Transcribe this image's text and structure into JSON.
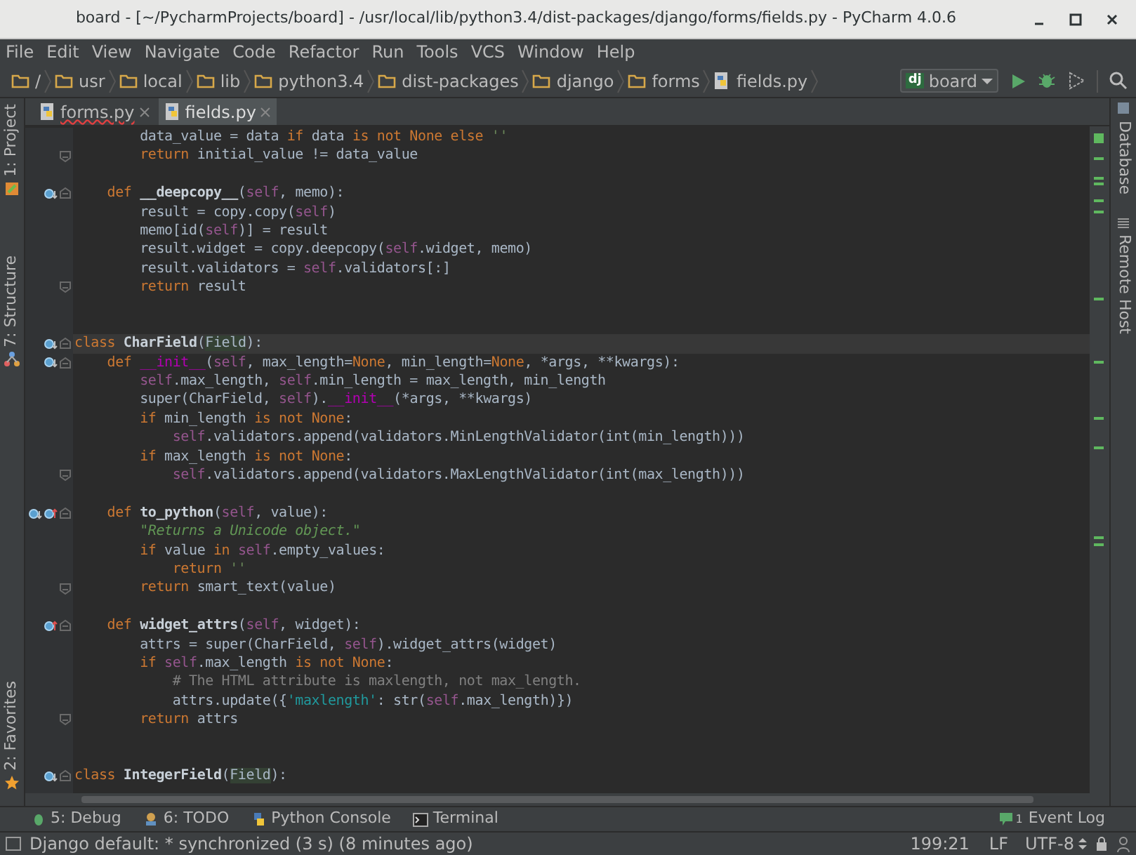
{
  "window": {
    "title": "board - [~/PycharmProjects/board] - /usr/local/lib/python3.4/dist-packages/django/forms/fields.py - PyCharm 4.0.6"
  },
  "menu": [
    "File",
    "Edit",
    "View",
    "Navigate",
    "Code",
    "Refactor",
    "Run",
    "Tools",
    "VCS",
    "Window",
    "Help"
  ],
  "breadcrumbs": [
    {
      "label": "/",
      "kind": "folder"
    },
    {
      "label": "usr",
      "kind": "folder"
    },
    {
      "label": "local",
      "kind": "folder"
    },
    {
      "label": "lib",
      "kind": "folder"
    },
    {
      "label": "python3.4",
      "kind": "folder"
    },
    {
      "label": "dist-packages",
      "kind": "folder"
    },
    {
      "label": "django",
      "kind": "folder"
    },
    {
      "label": "forms",
      "kind": "folder"
    },
    {
      "label": "fields.py",
      "kind": "file"
    }
  ],
  "run_config": {
    "badge": "dj",
    "label": "board"
  },
  "tabs": [
    {
      "label": "forms.py",
      "selected": false,
      "error": true
    },
    {
      "label": "fields.py",
      "selected": true,
      "error": false
    }
  ],
  "left_tools": [
    "1: Project",
    "7: Structure",
    "2: Favorites"
  ],
  "right_tools": [
    "Database",
    "Remote Host"
  ],
  "code_lines": [
    {
      "kind": "plain",
      "current": false,
      "tokens": [
        {
          "kind": "p",
          "text": "        data_value = data "
        },
        {
          "kind": "kw",
          "text": "if"
        },
        {
          "kind": "p",
          "text": " data "
        },
        {
          "kind": "kw",
          "text": "is not None else"
        },
        {
          "kind": "str",
          "text": " ''"
        }
      ]
    },
    {
      "kind": "fold_end",
      "current": false,
      "tokens": [
        {
          "kind": "kw",
          "text": "        return"
        },
        {
          "kind": "p",
          "text": " initial_value != data_value"
        }
      ]
    },
    {
      "kind": "blank",
      "current": false
    },
    {
      "kind": "fold_start",
      "current": false,
      "overrides": [
        {
          "kind": "down"
        }
      ],
      "tokens": [
        {
          "kind": "kw",
          "text": "    def"
        },
        {
          "kind": "fn",
          "text": " __deepcopy__"
        },
        {
          "kind": "p",
          "text": "("
        },
        {
          "kind": "self",
          "text": "self"
        },
        {
          "kind": "p",
          "text": ", memo):"
        }
      ]
    },
    {
      "kind": "plain",
      "current": false,
      "tokens": [
        {
          "kind": "p",
          "text": "        result = copy.copy("
        },
        {
          "kind": "self",
          "text": "self"
        },
        {
          "kind": "p",
          "text": ")"
        }
      ]
    },
    {
      "kind": "plain",
      "current": false,
      "tokens": [
        {
          "kind": "p",
          "text": "        memo[id("
        },
        {
          "kind": "self",
          "text": "self"
        },
        {
          "kind": "p",
          "text": ")] = result"
        }
      ]
    },
    {
      "kind": "plain",
      "current": false,
      "tokens": [
        {
          "kind": "p",
          "text": "        result.widget = copy.deepcopy("
        },
        {
          "kind": "self",
          "text": "self"
        },
        {
          "kind": "p",
          "text": ".widget, memo)"
        }
      ]
    },
    {
      "kind": "plain",
      "current": false,
      "tokens": [
        {
          "kind": "p",
          "text": "        result.validators = "
        },
        {
          "kind": "self",
          "text": "self"
        },
        {
          "kind": "p",
          "text": ".validators[:]"
        }
      ]
    },
    {
      "kind": "fold_end",
      "current": false,
      "tokens": [
        {
          "kind": "kw",
          "text": "        return"
        },
        {
          "kind": "p",
          "text": " result"
        }
      ]
    },
    {
      "kind": "blank",
      "current": false
    },
    {
      "kind": "blank",
      "current": false
    },
    {
      "kind": "fold_start",
      "current": true,
      "overrides": [
        {
          "kind": "down"
        }
      ],
      "tokens": [
        {
          "kind": "kw",
          "text": "class"
        },
        {
          "kind": "fn",
          "text": " CharField"
        },
        {
          "kind": "p",
          "text": "("
        },
        {
          "kind": "ref",
          "text": "Field"
        },
        {
          "kind": "p",
          "text": "):"
        }
      ]
    },
    {
      "kind": "fold_start",
      "current": false,
      "overrides": [
        {
          "kind": "down"
        }
      ],
      "tokens": [
        {
          "kind": "kw",
          "text": "    def"
        },
        {
          "kind": "magic",
          "text": " __init__"
        },
        {
          "kind": "p",
          "text": "("
        },
        {
          "kind": "self",
          "text": "self"
        },
        {
          "kind": "p",
          "text": ", max_length="
        },
        {
          "kind": "kw",
          "text": "None"
        },
        {
          "kind": "p",
          "text": ", min_length="
        },
        {
          "kind": "kw",
          "text": "None"
        },
        {
          "kind": "p",
          "text": ", *args, **kwargs):"
        }
      ]
    },
    {
      "kind": "plain",
      "current": false,
      "tokens": [
        {
          "kind": "self",
          "text": "        self"
        },
        {
          "kind": "p",
          "text": ".max_length, "
        },
        {
          "kind": "self",
          "text": "self"
        },
        {
          "kind": "p",
          "text": ".min_length = max_length, min_length"
        }
      ]
    },
    {
      "kind": "plain",
      "current": false,
      "tokens": [
        {
          "kind": "p",
          "text": "        super(CharField, "
        },
        {
          "kind": "self",
          "text": "self"
        },
        {
          "kind": "p",
          "text": ")."
        },
        {
          "kind": "magic",
          "text": "__init__"
        },
        {
          "kind": "p",
          "text": "(*args, **kwargs)"
        }
      ]
    },
    {
      "kind": "plain",
      "current": false,
      "tokens": [
        {
          "kind": "kw",
          "text": "        if"
        },
        {
          "kind": "p",
          "text": " min_length "
        },
        {
          "kind": "kw",
          "text": "is not None"
        },
        {
          "kind": "p",
          "text": ":"
        }
      ]
    },
    {
      "kind": "plain",
      "current": false,
      "tokens": [
        {
          "kind": "self",
          "text": "            self"
        },
        {
          "kind": "p",
          "text": ".validators.append(validators.MinLengthValidator(int(min_length)))"
        }
      ]
    },
    {
      "kind": "plain",
      "current": false,
      "tokens": [
        {
          "kind": "kw",
          "text": "        if"
        },
        {
          "kind": "p",
          "text": " max_length "
        },
        {
          "kind": "kw",
          "text": "is not None"
        },
        {
          "kind": "p",
          "text": ":"
        }
      ]
    },
    {
      "kind": "fold_end",
      "current": false,
      "tokens": [
        {
          "kind": "self",
          "text": "            self"
        },
        {
          "kind": "p",
          "text": ".validators.append(validators.MaxLengthValidator(int(max_length)))"
        }
      ]
    },
    {
      "kind": "blank",
      "current": false
    },
    {
      "kind": "fold_start",
      "current": false,
      "overrides": [
        {
          "kind": "down"
        },
        {
          "kind": "up"
        }
      ],
      "tokens": [
        {
          "kind": "kw",
          "text": "    def"
        },
        {
          "kind": "fn",
          "text": " to_python"
        },
        {
          "kind": "p",
          "text": "("
        },
        {
          "kind": "self",
          "text": "self"
        },
        {
          "kind": "p",
          "text": ", value):"
        }
      ]
    },
    {
      "kind": "plain",
      "current": false,
      "tokens": [
        {
          "kind": "doc",
          "text": "        \"Returns a Unicode object.\""
        }
      ]
    },
    {
      "kind": "plain",
      "current": false,
      "tokens": [
        {
          "kind": "kw",
          "text": "        if"
        },
        {
          "kind": "p",
          "text": " value "
        },
        {
          "kind": "kw",
          "text": "in"
        },
        {
          "kind": "self",
          "text": " self"
        },
        {
          "kind": "p",
          "text": ".empty_values:"
        }
      ]
    },
    {
      "kind": "plain",
      "current": false,
      "tokens": [
        {
          "kind": "kw",
          "text": "            return"
        },
        {
          "kind": "str",
          "text": " ''"
        }
      ]
    },
    {
      "kind": "fold_end",
      "current": false,
      "tokens": [
        {
          "kind": "kw",
          "text": "        return"
        },
        {
          "kind": "p",
          "text": " smart_text(value)"
        }
      ]
    },
    {
      "kind": "blank",
      "current": false
    },
    {
      "kind": "fold_start",
      "current": false,
      "overrides": [
        {
          "kind": "up"
        }
      ],
      "tokens": [
        {
          "kind": "kw",
          "text": "    def"
        },
        {
          "kind": "fn",
          "text": " widget_attrs"
        },
        {
          "kind": "p",
          "text": "("
        },
        {
          "kind": "self",
          "text": "self"
        },
        {
          "kind": "p",
          "text": ", widget):"
        }
      ]
    },
    {
      "kind": "plain",
      "current": false,
      "tokens": [
        {
          "kind": "p",
          "text": "        attrs = super(CharField, "
        },
        {
          "kind": "self",
          "text": "self"
        },
        {
          "kind": "p",
          "text": ").widget_attrs(widget)"
        }
      ]
    },
    {
      "kind": "plain",
      "current": false,
      "tokens": [
        {
          "kind": "kw",
          "text": "        if"
        },
        {
          "kind": "self",
          "text": " self"
        },
        {
          "kind": "p",
          "text": ".max_length "
        },
        {
          "kind": "kw",
          "text": "is not None"
        },
        {
          "kind": "p",
          "text": ":"
        }
      ]
    },
    {
      "kind": "plain",
      "current": false,
      "tokens": [
        {
          "kind": "cmt",
          "text": "            # The HTML attribute is maxlength, not max_length."
        }
      ]
    },
    {
      "kind": "plain",
      "current": false,
      "tokens": [
        {
          "kind": "p",
          "text": "            attrs.update({"
        },
        {
          "kind": "str2",
          "text": "'maxlength'"
        },
        {
          "kind": "p",
          "text": ": str("
        },
        {
          "kind": "self",
          "text": "self"
        },
        {
          "kind": "p",
          "text": ".max_length)})"
        }
      ]
    },
    {
      "kind": "fold_end",
      "current": false,
      "tokens": [
        {
          "kind": "kw",
          "text": "        return"
        },
        {
          "kind": "p",
          "text": " attrs"
        }
      ]
    },
    {
      "kind": "blank",
      "current": false
    },
    {
      "kind": "blank",
      "current": false
    },
    {
      "kind": "fold_start",
      "current": false,
      "overrides": [
        {
          "kind": "down"
        }
      ],
      "tokens": [
        {
          "kind": "kw",
          "text": "class"
        },
        {
          "kind": "fn",
          "text": " IntegerField"
        },
        {
          "kind": "p",
          "text": "("
        },
        {
          "kind": "ref",
          "text": "Field"
        },
        {
          "kind": "p",
          "text": "):"
        }
      ]
    }
  ],
  "bottom_tools": [
    {
      "label": "5: Debug",
      "kind": "debug"
    },
    {
      "label": "6: TODO",
      "kind": "todo"
    },
    {
      "label": "Python Console",
      "kind": "console"
    },
    {
      "label": "Terminal",
      "kind": "terminal"
    }
  ],
  "event_log": {
    "label": "Event Log",
    "count": "1"
  },
  "status_bar": {
    "message": "Django default: * synchronized (3 s) (8 minutes ago)",
    "position": "199:21",
    "line_ending": "LF",
    "encoding": "UTF-8"
  }
}
